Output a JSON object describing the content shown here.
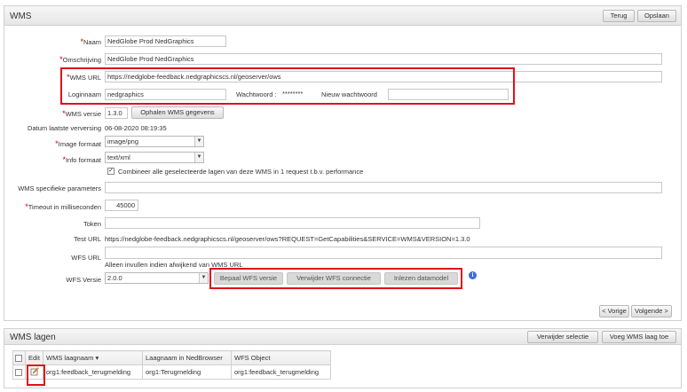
{
  "wms_panel": {
    "title": "WMS",
    "back_label": "Terug",
    "save_label": "Opslaan"
  },
  "form": {
    "naam": {
      "label": "Naam",
      "value": "NedGlobe Prod NedGraphics"
    },
    "omschrijving": {
      "label": "Omschrijving",
      "value": "NedGlobe Prod NedGraphics"
    },
    "wms_url": {
      "label": "WMS URL",
      "value": "https://nedglobe-feedback.nedgraphicscs.nl/geoserver/ows"
    },
    "loginnaam": {
      "label": "Loginnaam",
      "value": "nedgraphics"
    },
    "wachtwoord": {
      "label": "Wachtwoord :",
      "value": "********"
    },
    "nieuw_wachtwoord": {
      "label": "Nieuw wachtwoord",
      "value": ""
    },
    "wms_versie": {
      "label": "WMS versie",
      "value": "1.3.0",
      "fetch_label": "Ophalen WMS gegevens"
    },
    "datum": {
      "label": "Datum laatste verversing",
      "value": "06-08-2020 08:19:35"
    },
    "image_formaat": {
      "label": "Image formaat",
      "value": "image/png"
    },
    "info_formaat": {
      "label": "Info formaat",
      "value": "text/xml"
    },
    "combine": {
      "label": "Combineer alle geselecteerde lagen van deze WMS in 1 request t.b.v. performance",
      "checked": true
    },
    "specifieke": {
      "label": "WMS specifieke parameters",
      "value": ""
    },
    "timeout": {
      "label": "Timeout in milliseconden",
      "value": "45000"
    },
    "token": {
      "label": "Token",
      "value": ""
    },
    "test_url": {
      "label": "Test URL",
      "value": "https://nedglobe-feedback.nedgraphicscs.nl/geoserver/ows?REQUEST=GetCapabilities&SERVICE=WMS&VERSION=1.3.0"
    },
    "wfs_url": {
      "label": "WFS URL",
      "value": "",
      "hint": "Alleen invullen indien afwijkend van WMS URL"
    },
    "wfs_versie": {
      "label": "WFS Versie",
      "value": "2.0.0"
    },
    "bepaal_label": "Bepaal WFS versie",
    "verwijder_label": "Verwijder WFS connectie",
    "inlezen_label": "Inlezen datamodel",
    "info_icon": "info-icon"
  },
  "pager": {
    "prev_label": "< Vorige",
    "next_label": "Volgende >"
  },
  "layers_panel": {
    "title": "WMS lagen",
    "remove_label": "Verwijder selectie",
    "add_label": "Voeg WMS laag toe",
    "columns": [
      "Edit",
      "WMS laagnaam",
      "Laagnaam in NedBrowser",
      "WFS Object"
    ],
    "sort_indicator": "▾",
    "rows": [
      {
        "edit_icon": "edit-icon",
        "wms_laagnaam": "org1:feedback_terugmelding",
        "laagnaam": "org1:Terugmelding",
        "wfs_object": "org1:feedback_terugmelding"
      }
    ]
  },
  "colors": {
    "required": "#cc0000",
    "highlight": "#e0101b"
  }
}
